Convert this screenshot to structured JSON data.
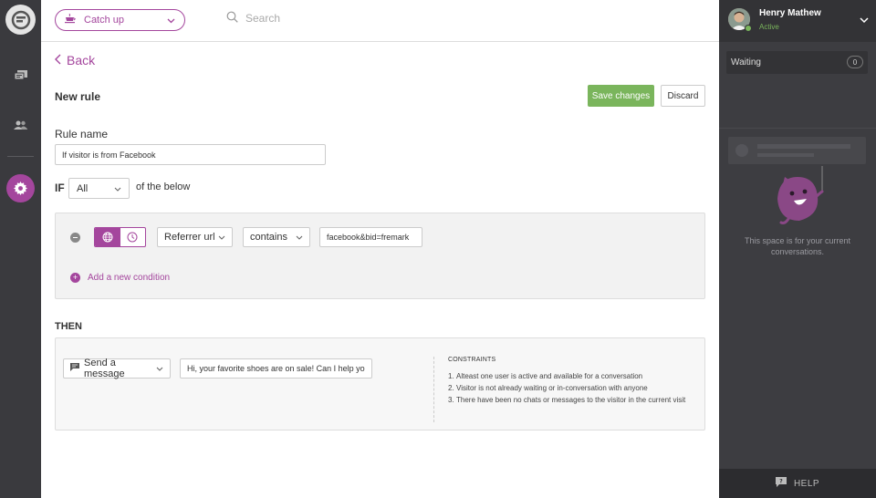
{
  "topbar": {
    "status_label": "Catch up",
    "search_placeholder": "Search"
  },
  "rule": {
    "back_label": "Back",
    "title": "New rule",
    "save_label": "Save changes",
    "discard_label": "Discard",
    "name_label": "Rule name",
    "name_value": "If visitor is from Facebook",
    "if_label": "IF",
    "match_value": "All",
    "match_suffix": "of the below",
    "condition": {
      "field": "Referrer url",
      "operator": "contains",
      "value": "facebook&bid=fremark"
    },
    "add_condition_label": "Add a new condition",
    "then_label": "THEN",
    "action": {
      "type": "Send a message",
      "message": "Hi, your favorite shoes are on sale! Can I help you?"
    },
    "constraints": {
      "heading": "CONSTRAINTS",
      "items": [
        {
          "n": "1.",
          "text": "Alteast one user is active and available for a conversation"
        },
        {
          "n": "2.",
          "text": "Visitor is not already waiting or in-conversation with anyone"
        },
        {
          "n": "3.",
          "text": "There have been no chats or messages to the visitor in the current visit"
        }
      ]
    }
  },
  "user": {
    "name": "Henry Mathew",
    "status": "Active"
  },
  "queue": {
    "waiting_label": "Waiting",
    "waiting_count": "0",
    "empty_text": "This space is for your current conversations."
  },
  "help": {
    "label": "HELP"
  },
  "colors": {
    "accent": "#a4469d",
    "success": "#7ab55c",
    "nav_bg": "#3a3a3e",
    "panel_bg": "#3d3d41"
  }
}
